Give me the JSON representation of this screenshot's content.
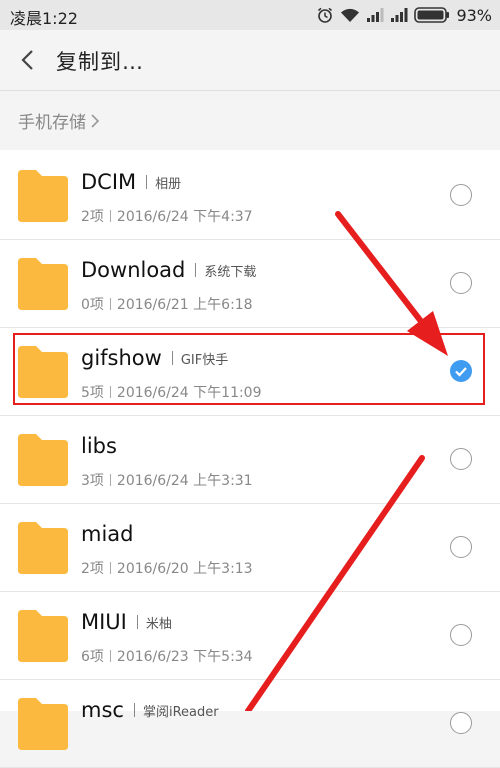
{
  "status_bar": {
    "time": "凌晨1:22",
    "battery_percent": "93%",
    "icons": [
      "alarm-clock-icon",
      "wifi-icon",
      "signal-icon",
      "signal-icon",
      "battery-icon"
    ]
  },
  "header": {
    "title": "复制到…",
    "back_icon": "back-arrow-icon"
  },
  "breadcrumb": {
    "label": "手机存储"
  },
  "folders": [
    {
      "name": "DCIM",
      "alias": "相册",
      "count": "2项",
      "date": "2016/6/24 下午4:37",
      "selected": false
    },
    {
      "name": "Download",
      "alias": "系统下载",
      "count": "0项",
      "date": "2016/6/21 上午6:18",
      "selected": false
    },
    {
      "name": "gifshow",
      "alias": "GIF快手",
      "count": "5项",
      "date": "2016/6/24 下午11:09",
      "selected": true
    },
    {
      "name": "libs",
      "alias": "",
      "count": "3项",
      "date": "2016/6/24 上午3:31",
      "selected": false
    },
    {
      "name": "miad",
      "alias": "",
      "count": "2项",
      "date": "2016/6/20 上午3:13",
      "selected": false
    },
    {
      "name": "MIUI",
      "alias": "米柚",
      "count": "6项",
      "date": "2016/6/23 下午5:34",
      "selected": false
    },
    {
      "name": "msc",
      "alias": "掌阅iReader",
      "count": "",
      "date": "",
      "selected": false
    }
  ],
  "colors": {
    "folder": "#fbb93f",
    "accent": "#3f9cf0",
    "annotation": "#e61e1e"
  }
}
